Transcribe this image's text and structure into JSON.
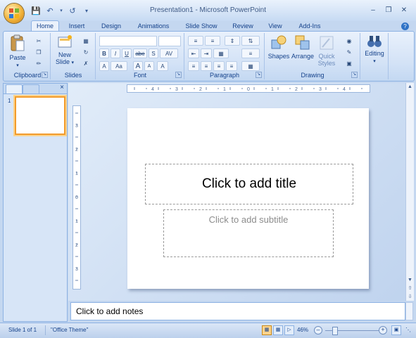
{
  "window": {
    "title": "Presentation1 - Microsoft PowerPoint"
  },
  "qat": {
    "icons": [
      "save-icon",
      "undo-icon",
      "redo-icon",
      "customize-qat-icon"
    ]
  },
  "tabs": [
    {
      "label": "Home",
      "active": true
    },
    {
      "label": "Insert"
    },
    {
      "label": "Design"
    },
    {
      "label": "Animations"
    },
    {
      "label": "Slide Show"
    },
    {
      "label": "Review"
    },
    {
      "label": "View"
    },
    {
      "label": "Add-Ins"
    }
  ],
  "ribbon": {
    "clipboard": {
      "label": "Clipboard",
      "paste": "Paste"
    },
    "slides": {
      "label": "Slides",
      "new_slide_line1": "New",
      "new_slide_line2": "Slide"
    },
    "font": {
      "label": "Font",
      "bold": "B",
      "italic": "I",
      "underline": "U",
      "strike": "abe",
      "shadow": "S",
      "spacing": "AV",
      "case": "Aa",
      "grow": "A",
      "shrink": "A",
      "clear": "A"
    },
    "paragraph": {
      "label": "Paragraph"
    },
    "drawing": {
      "label": "Drawing",
      "shapes": "Shapes",
      "arrange": "Arrange",
      "quick_styles_line1": "Quick",
      "quick_styles_line2": "Styles"
    },
    "editing": {
      "label": "Editing"
    }
  },
  "slides_pane": {
    "slide_number": "1"
  },
  "slide": {
    "title_placeholder": "Click to add title",
    "subtitle_placeholder": "Click to add subtitle"
  },
  "notes": {
    "placeholder": "Click to add notes"
  },
  "status": {
    "slide_info": "Slide 1 of 1",
    "theme": "\"Office Theme\"",
    "zoom": "46%",
    "zoom_level": 0.46
  },
  "rulers": {
    "horizontal_ticks": [
      "4",
      "3",
      "2",
      "1",
      "0",
      "1",
      "2",
      "3",
      "4"
    ],
    "vertical_ticks": [
      "3",
      "2",
      "1",
      "0",
      "1",
      "2",
      "3"
    ]
  },
  "colors": {
    "accent": "#15428b",
    "selection": "#f29b2b",
    "ribbon": "#d3e2f6"
  }
}
